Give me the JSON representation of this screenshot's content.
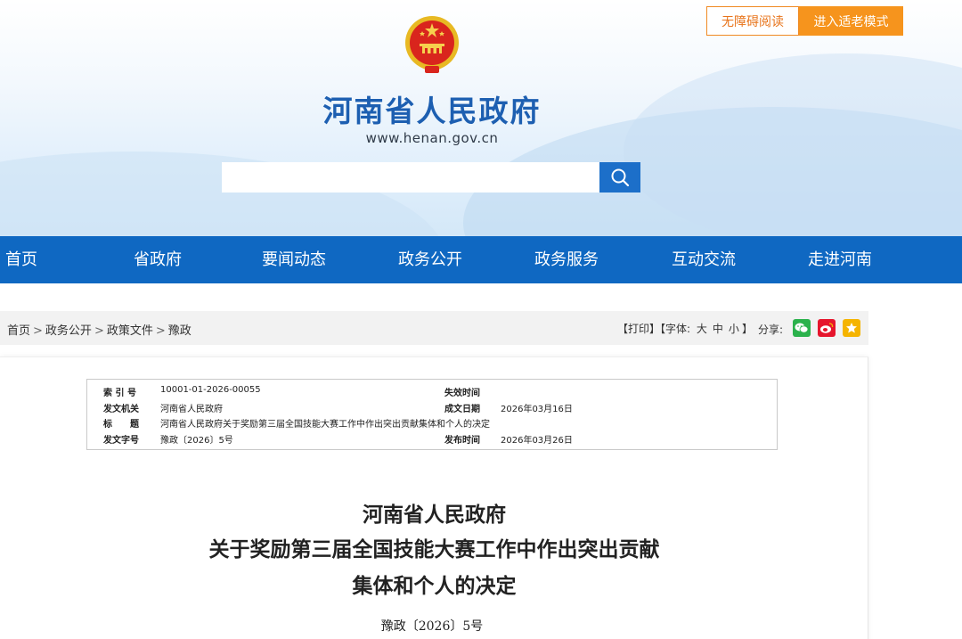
{
  "header": {
    "accessible_label": "无障碍阅读",
    "elder_mode_label": "进入适老模式",
    "site_title": "河南省人民政府",
    "site_url": "www.henan.gov.cn",
    "search_placeholder": ""
  },
  "nav": {
    "items": [
      "首页",
      "省政府",
      "要闻动态",
      "政务公开",
      "政务服务",
      "互动交流",
      "走进河南"
    ]
  },
  "breadcrumb": {
    "items": [
      "首页",
      "政务公开",
      "政策文件",
      "豫政"
    ],
    "separator": ">"
  },
  "tools": {
    "print": "【打印】",
    "font_open": "【字体:",
    "font_large": "大",
    "font_medium": "中",
    "font_small": "小",
    "font_close": "】",
    "share_label": "分享:"
  },
  "meta": {
    "index_label": "索 引 号",
    "index_value": "10001-01-2026-00055",
    "expire_label": "失效时间",
    "expire_value": "",
    "issuer_label": "发文机关",
    "issuer_value": "河南省人民政府",
    "created_label": "成文日期",
    "created_value": "2026年03月16日",
    "title_label": "标　　题",
    "title_value": "河南省人民政府关于奖励第三届全国技能大赛工作中作出突出贡献集体和个人的决定",
    "docno_label": "发文字号",
    "docno_value": "豫政〔2026〕5号",
    "published_label": "发布时间",
    "published_value": "2026年03月26日"
  },
  "document": {
    "title_line1": "河南省人民政府",
    "title_line2": "关于奖励第三届全国技能大赛工作中作出突出贡献",
    "title_line3": "集体和个人的决定",
    "number": "豫政〔2026〕5号"
  },
  "colors": {
    "brand_blue": "#0f68c2",
    "title_blue": "#1d5fb1",
    "accent_orange": "#f6941d",
    "wechat_green": "#2bb24c",
    "weibo_red": "#e6162d",
    "favorite_yellow": "#f5b400"
  },
  "icons": {
    "search": "search-icon",
    "emblem": "national-emblem",
    "wechat": "wechat-icon",
    "weibo": "weibo-icon",
    "favorite": "star-icon"
  }
}
